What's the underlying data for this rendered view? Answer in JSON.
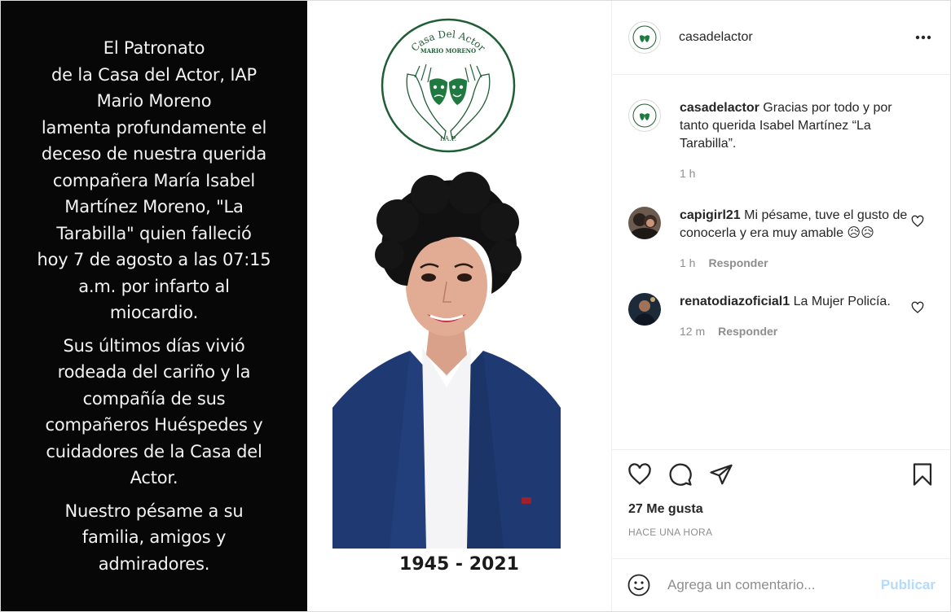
{
  "post_image": {
    "left_text": [
      "El Patronato",
      "de la Casa del Actor, IAP",
      "Mario Moreno",
      "lamenta profundamente el",
      "deceso de nuestra querida",
      "compañera María  Isabel",
      "Martínez Moreno, \"La",
      "Tarabilla\" quien falleció",
      "hoy 7 de agosto a  las 07:15",
      "a.m. por infarto al",
      "miocardio."
    ],
    "left_text_2": [
      "Sus últimos días vivió",
      "rodeada del cariño y la",
      "compañía de sus",
      "compañeros Huéspedes y",
      "cuidadores de la Casa del",
      "Actor."
    ],
    "left_text_3": [
      "Nuestro pésame a su",
      "familia, amigos y",
      "admiradores."
    ],
    "logo": {
      "top_text": "Casa Del Actor",
      "sub_text": "MARIO MORENO",
      "bottom_text": "I.A.P."
    },
    "years": "1945 - 2021"
  },
  "header": {
    "username": "casadelactor"
  },
  "comments": [
    {
      "user": "casadelactor",
      "text": "Gracias por todo y por tanto querida Isabel Martínez “La Tarabilla”.",
      "time": "1 h",
      "reply": ""
    },
    {
      "user": "capigirl21",
      "text": "Mi pésame, tuve el gusto de conocerla y era muy amable 😥😥",
      "time": "1 h",
      "reply": "Responder"
    },
    {
      "user": "renatodiazoficial1",
      "text": "La Mujer Policía.",
      "time": "12 m",
      "reply": "Responder"
    }
  ],
  "likes": "27 Me gusta",
  "time_ago": "HACE UNA HORA",
  "add_comment": {
    "placeholder": "Agrega un comentario...",
    "publish_label": "Publicar"
  },
  "icons": {
    "more": "more-icon",
    "like": "heart-icon",
    "comment": "comment-icon",
    "share": "share-icon",
    "save": "bookmark-icon",
    "emoji": "emoji-icon"
  },
  "colors": {
    "brand_green": "#1f6b3a",
    "publish_disabled": "#b3dbff",
    "muted_text": "#8e8e8e"
  }
}
